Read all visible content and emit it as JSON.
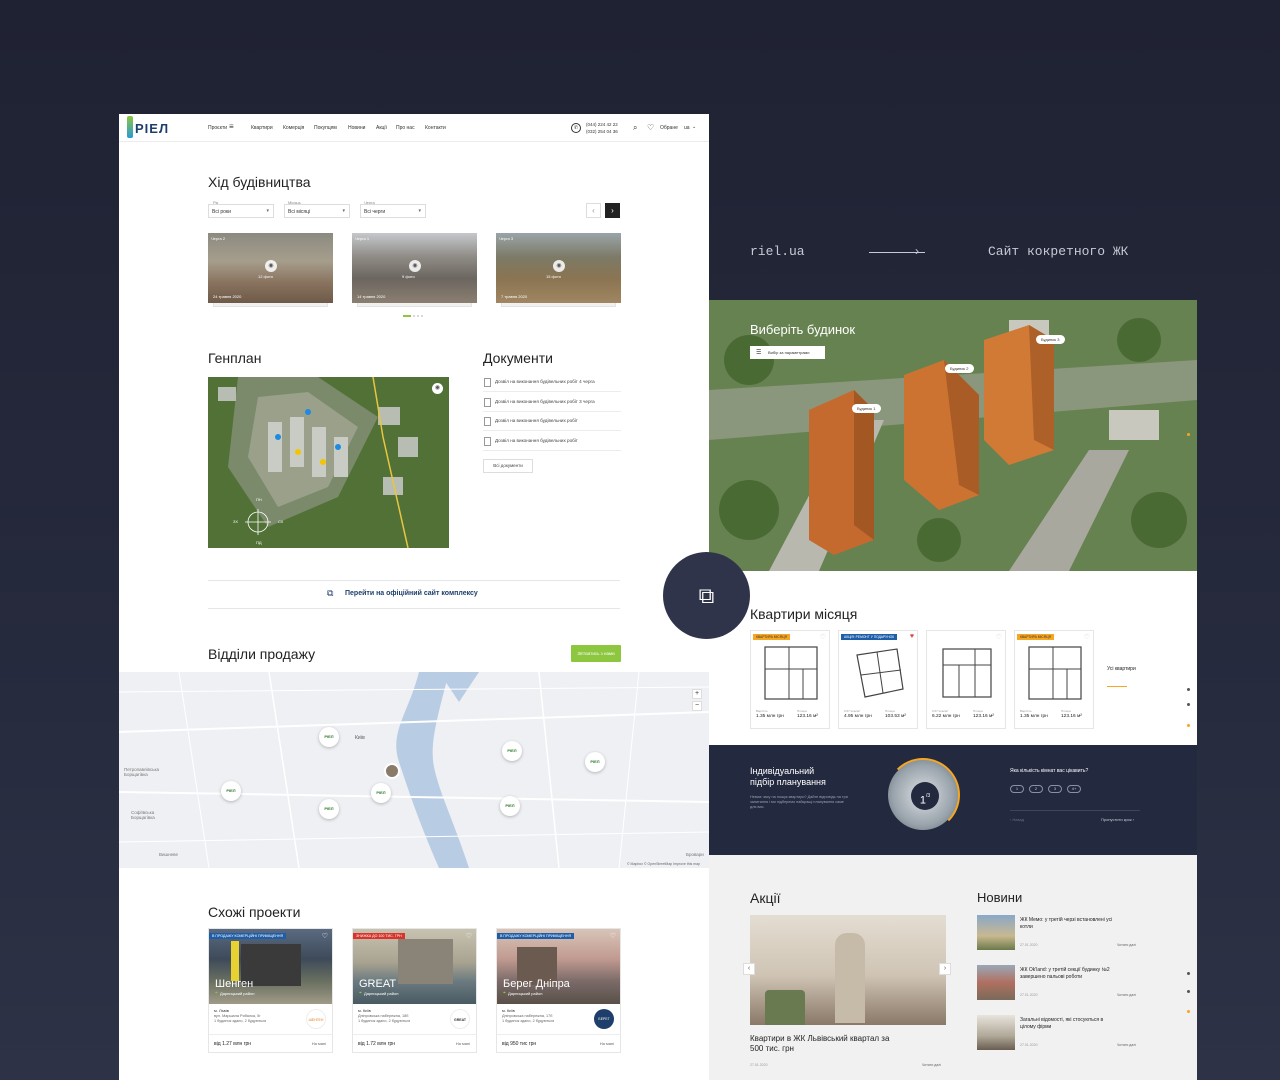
{
  "labels": {
    "riel": "riel.ua",
    "arrow": "⟶",
    "site": "Сайт кокретного ЖК"
  },
  "header": {
    "logo": "РІЕЛ",
    "nav": [
      "Проєкти",
      "Квартири",
      "Комерція",
      "Покупцям",
      "Новини",
      "Акції",
      "Про нас",
      "Контакти"
    ],
    "phone1": "(044) 224 42 22",
    "phone2": "(032) 254 04 36",
    "fav_label": "Обране",
    "lang": "ua"
  },
  "construction": {
    "title": "Хід будівництва",
    "filters": [
      {
        "label": "Рік",
        "value": "Всі роки"
      },
      {
        "label": "Місяць",
        "value": "Всі місяці"
      },
      {
        "label": "Черга",
        "value": "Всі черги"
      }
    ],
    "photos": [
      {
        "top": "Черга 2",
        "count": "12 фото",
        "date": "24 травня 2020"
      },
      {
        "top": "Черга 1",
        "count": "9 фото",
        "date": "14 травня 2020"
      },
      {
        "top": "Черга 3",
        "count": "15 фото",
        "date": "7 травня 2020"
      }
    ]
  },
  "genplan": {
    "title": "Генплан",
    "compass": [
      "ПН",
      "ПД",
      "СХ",
      "ЗХ"
    ]
  },
  "documents": {
    "title": "Документи",
    "items": [
      "Дозвіл на виконання будівельних робіт 4 черга",
      "Дозвіл на виконання будівельних робіт 3 черга",
      "Дозвіл на виконання будівельних робіт",
      "Дозвіл на виконання будівельних робіт"
    ],
    "all_button": "Всі документи"
  },
  "official_link": "Перейти на офіційний сайт комплексу",
  "sales": {
    "title": "Відділи продажу",
    "call_button": "Зв'язатись з нами",
    "map_labels": [
      "Київ",
      "Петропавлівська Борщагівка",
      "Софіївська Борщагівка",
      "Вишневе",
      "Бровари"
    ],
    "pin_label": "РІЕЛ",
    "attribution": "© Mapbox © OpenStreetMap Improve this map"
  },
  "similar": {
    "title": "Схожі проекти",
    "cards": [
      {
        "badge": "В ПРОДАЖУ КОМЕРЦІЙНІ ПРИМІЩЕННЯ",
        "name": "Шенген",
        "district": "Дарницький район",
        "city": "м. Львів",
        "addr": "вул. Маршала Рибалка, 5г",
        "stages": "1 будинок здано, 2 будуються",
        "price": "від 1.27 млн грн",
        "map": "На мапі",
        "logo": "ШЕНГЕН"
      },
      {
        "badge": "ЗНИЖКА ДО 100 ТИС. ГРН",
        "name": "GREAT",
        "district": "Дарницький район",
        "city": "м. Київ",
        "addr": "Дніпровська набережна, 18б",
        "stages": "1 будинок здано, 2 будуються",
        "price": "від 1.72 млн грн",
        "map": "На мапі",
        "logo": "GREAT"
      },
      {
        "badge": "В ПРОДАЖУ КОМЕРЦІЙНІ ПРИМІЩЕННЯ",
        "name": "Берег Дніпра",
        "district": "Дарницький район",
        "city": "м. Київ",
        "addr": "Дніпровська набережна, 17б",
        "stages": "1 будинок здано, 2 будуються",
        "price": "від 950 тис грн",
        "map": "На мапі",
        "logo": "БЕРЕГ"
      }
    ]
  },
  "hero": {
    "title": "Виберіть будинок",
    "filter_button": "Вибір за параметрами",
    "buildings": [
      "Будинок 1",
      "Будинок 2",
      "Будинок 3"
    ]
  },
  "month": {
    "title": "Квартири місяця",
    "all_link": "Усі квартири",
    "cards": [
      {
        "badge": "КВАРТИРА МІСЯЦЯ",
        "badge_color": "#f5a623",
        "s1": "Вартість",
        "v1": "1.35 млн грн",
        "s2": "Площа",
        "v2": "123.16 м²",
        "heart": "♡"
      },
      {
        "badge": "АКЦІЯ: РЕМОНТ У ПОДАРУНОК",
        "badge_color": "#1e5ea8",
        "s1": "0.67 млн/м²",
        "v1": "4.95 млн грн",
        "s2": "Площа",
        "v2": "103.53 м²",
        "heart": "♥"
      },
      {
        "badge": "",
        "badge_color": "",
        "s1": "0.67 млн/м²",
        "v1": "6.22 млн грн",
        "s2": "Площа",
        "v2": "123.16 м²",
        "heart": "♡"
      },
      {
        "badge": "КВАРТИРА МІСЯЦЯ",
        "badge_color": "#f5a623",
        "s1": "Вартість",
        "v1": "1.35 млн грн",
        "s2": "Площа",
        "v2": "123.16 м²",
        "heart": "♡"
      }
    ]
  },
  "picker": {
    "title1": "Індивідуальний",
    "title2": "підбір планування",
    "desc": "Немає часу на пошук квартири? Дайте відповідь на три запитання і ми підберемо найкращі планування саме для вас.",
    "step": "1",
    "step_total": "/3",
    "question": "Яка кількість кімнат вас цікавить?",
    "options": [
      "1",
      "2",
      "3",
      "4+"
    ],
    "back": "Назад",
    "skip": "Пропустити крок"
  },
  "promos": {
    "title": "Акції",
    "caption": "Квартири в ЖК Львівський квартал за 500 тис. грн",
    "date": "27.01.2020",
    "more": "Читати далі"
  },
  "news": {
    "title": "Новини",
    "items": [
      {
        "title": "ЖК Мемо: у третій черзі встановлені усі котли",
        "date": "27.01.2020",
        "more": "Читати далі"
      },
      {
        "title": "ЖК Ok'land: у третій секції будинку №2 завершено пальові роботи",
        "date": "27.01.2020",
        "more": "Читати далі"
      },
      {
        "title": "Загальні відомості, які стосуються в цілому фірми",
        "date": "27.01.2020",
        "more": "Читати далі"
      }
    ]
  },
  "colors": {
    "background": "#23263a",
    "green": "#8dc63f",
    "navy": "#23293e",
    "orange": "#f5a623",
    "blue": "#1e5ea8"
  }
}
